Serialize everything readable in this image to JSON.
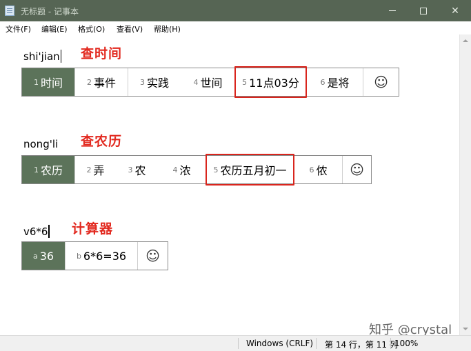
{
  "window": {
    "title": "无标题 - 记事本",
    "minimize_label": "",
    "maximize_label": "",
    "close_label": "✕"
  },
  "menu": {
    "items": [
      "文件(F)",
      "编辑(E)",
      "格式(O)",
      "查看(V)",
      "帮助(H)"
    ]
  },
  "sections": [
    {
      "typed": "shi'jian",
      "annotation": "查时间",
      "candidates": [
        {
          "num": "1",
          "text": "时间"
        },
        {
          "num": "2",
          "text": "事件"
        },
        {
          "num": "3",
          "text": "实践"
        },
        {
          "num": "4",
          "text": "世间"
        },
        {
          "num": "5",
          "text": "11点03分"
        },
        {
          "num": "6",
          "text": "是将"
        }
      ],
      "selected_index": 0,
      "highlighted_index": 4,
      "emoji": "☺"
    },
    {
      "typed": "nong'li",
      "annotation": "查农历",
      "candidates": [
        {
          "num": "1",
          "text": "农历"
        },
        {
          "num": "2",
          "text": "弄"
        },
        {
          "num": "3",
          "text": "农"
        },
        {
          "num": "4",
          "text": "浓"
        },
        {
          "num": "5",
          "text": "农历五月初一"
        },
        {
          "num": "6",
          "text": "侬"
        }
      ],
      "selected_index": 0,
      "highlighted_index": 4,
      "emoji": "☺"
    },
    {
      "typed": "v6*6",
      "annotation": "计算器",
      "candidates": [
        {
          "num": "a",
          "text": "36"
        },
        {
          "num": "b",
          "text": "6*6=36"
        }
      ],
      "selected_index": 0,
      "highlighted_index": null,
      "emoji": "☺"
    }
  ],
  "statusbar": {
    "encoding": "Windows (CRLF)",
    "position": "第 14 行，第 11 列",
    "zoom": "100%"
  },
  "watermark": "知乎 @crystal",
  "colors": {
    "titlebar": "#566554",
    "selected_candidate": "#5c735a",
    "annotation": "#e2291f",
    "highlight_box": "#d9251d"
  }
}
